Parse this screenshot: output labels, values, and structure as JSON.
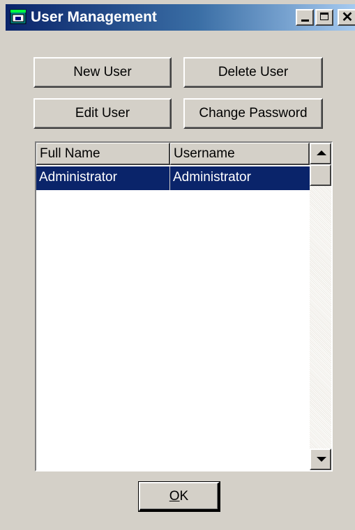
{
  "window": {
    "title": "User Management"
  },
  "toolbar": {
    "new_user": "New User",
    "delete_user": "Delete User",
    "edit_user": "Edit User",
    "change_password": "Change Password"
  },
  "table": {
    "columns": [
      "Full Name",
      "Username"
    ],
    "rows": [
      {
        "full_name": "Administrator",
        "username": "Administrator",
        "selected": true
      }
    ]
  },
  "footer": {
    "ok_mnemonic": "O",
    "ok_rest": "K"
  },
  "colors": {
    "titlebar_start": "#0a246a",
    "titlebar_end": "#a6caf0",
    "selection": "#0a246a",
    "face": "#d4d0c8"
  },
  "icons": {
    "app": "app-window-icon",
    "minimize": "minimize-icon",
    "maximize": "maximize-icon",
    "close": "close-icon",
    "scroll_up": "arrow-up-icon",
    "scroll_down": "arrow-down-icon"
  }
}
